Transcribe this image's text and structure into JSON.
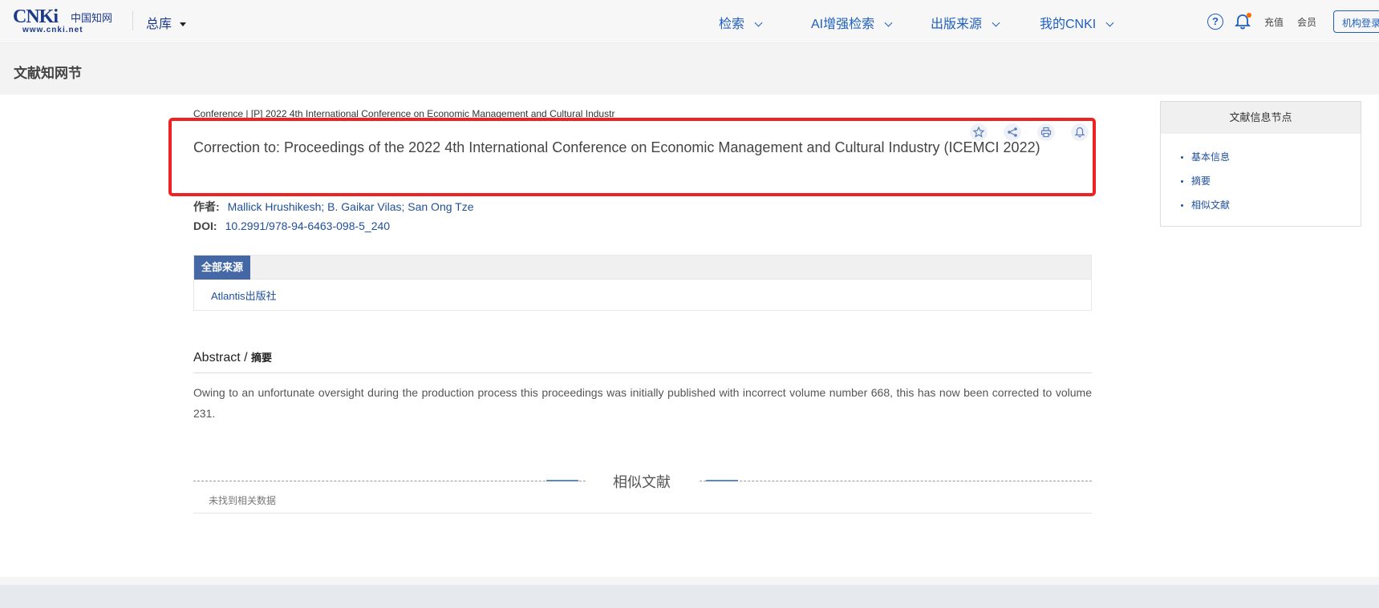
{
  "header": {
    "logo_text": "CNKi",
    "logo_cn": "中国知网",
    "logo_url": "www.cnki.net",
    "library": "总库",
    "nav": [
      {
        "label": "检索"
      },
      {
        "label": "AI增强检索"
      },
      {
        "label": "出版来源"
      },
      {
        "label": "我的CNKI"
      }
    ],
    "recharge": "充值",
    "member": "会员",
    "login": "机构登录"
  },
  "subheader": {
    "title": "文献知网节"
  },
  "article": {
    "breadcrumb": "Conference | [P] 2022 4th International Conference on Economic Management and Cultural Industr",
    "title": "Correction to: Proceedings of the 2022 4th International Conference on Economic Management and Cultural Industry (ICEMCI 2022)",
    "author_label": "作者:",
    "authors": "Mallick Hrushikesh; B. Gaikar Vilas; San Ong Tze",
    "doi_label": "DOI:",
    "doi": "10.2991/978-94-6463-098-5_240",
    "source_tab": "全部来源",
    "source": "Atlantis出版社",
    "abstract_en": "Abstract",
    "abstract_slash": " / ",
    "abstract_cn": "摘要",
    "abstract_text": "Owing to an unfortunate oversight during the production process this proceedings was initially published with incorrect volume number 668, this has now been corrected to volume 231."
  },
  "similar": {
    "title": "相似文献",
    "empty": "未找到相关数据"
  },
  "sidebar": {
    "title": "文献信息节点",
    "items": [
      {
        "label": "基本信息"
      },
      {
        "label": "摘要"
      },
      {
        "label": "相似文献"
      }
    ]
  },
  "colors": {
    "brand": "#1b3a8a",
    "link": "#1f4f9c",
    "highlight": "#ee2222"
  }
}
